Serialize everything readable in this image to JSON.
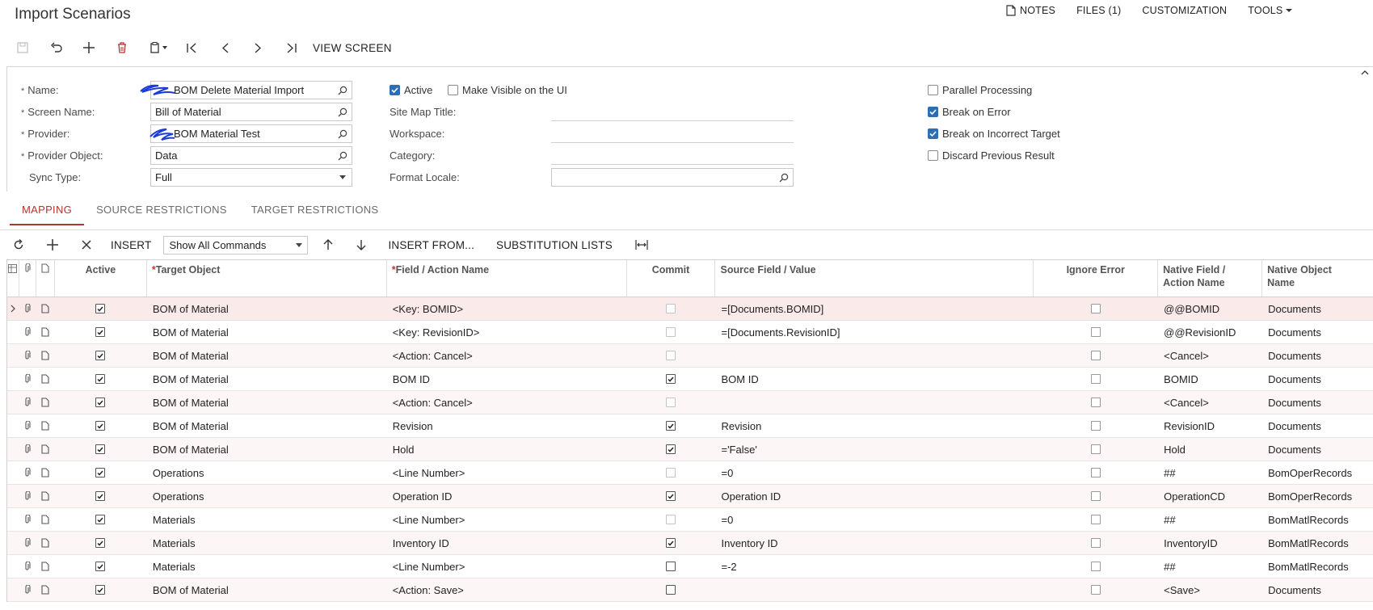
{
  "page": {
    "title": "Import Scenarios"
  },
  "topnav": {
    "notes": "NOTES",
    "files": "FILES (1)",
    "customization": "CUSTOMIZATION",
    "tools": "TOOLS"
  },
  "toolbar": {
    "view_screen": "VIEW SCREEN"
  },
  "form": {
    "name_label": "Name:",
    "name_value": "BOM Delete Material Import",
    "screen_label": "Screen Name:",
    "screen_value": "Bill of Material",
    "provider_label": "Provider:",
    "provider_value": "BOM Material Test",
    "provider_object_label": "Provider Object:",
    "provider_object_value": "Data",
    "sync_label": "Sync Type:",
    "sync_value": "Full",
    "active_label": "Active",
    "active_checked": true,
    "visible_label": "Make Visible on the UI",
    "visible_checked": false,
    "sitemap_label": "Site Map Title:",
    "workspace_label": "Workspace:",
    "category_label": "Category:",
    "locale_label": "Format Locale:",
    "parallel_label": "Parallel Processing",
    "parallel_checked": false,
    "break_error_label": "Break on Error",
    "break_error_checked": true,
    "break_target_label": "Break on Incorrect Target",
    "break_target_checked": true,
    "discard_label": "Discard Previous Result",
    "discard_checked": false
  },
  "tabs": [
    "MAPPING",
    "SOURCE RESTRICTIONS",
    "TARGET RESTRICTIONS"
  ],
  "grid_toolbar": {
    "insert": "INSERT",
    "show_commands": "Show All Commands",
    "insert_from": "INSERT FROM...",
    "substitution": "SUBSTITUTION LISTS"
  },
  "grid": {
    "headers": {
      "active": "Active",
      "target": "Target Object",
      "field": "Field / Action Name",
      "commit": "Commit",
      "source": "Source Field / Value",
      "ignore": "Ignore Error",
      "native_field_1": "Native Field /",
      "native_field_2": "Action Name",
      "native_object_1": "Native Object",
      "native_object_2": "Name"
    },
    "rows": [
      {
        "active": true,
        "target": "BOM of Material",
        "field": "<Key: BOMID>",
        "commit": false,
        "commit_disabled": true,
        "source": "=[Documents.BOMID]",
        "ignore": false,
        "native_field": "@@BOMID",
        "native_object": "Documents"
      },
      {
        "active": true,
        "target": "BOM of Material",
        "field": "<Key: RevisionID>",
        "commit": false,
        "commit_disabled": true,
        "source": "=[Documents.RevisionID]",
        "ignore": false,
        "native_field": "@@RevisionID",
        "native_object": "Documents"
      },
      {
        "active": true,
        "target": "BOM of Material",
        "field": "<Action: Cancel>",
        "commit": false,
        "commit_disabled": true,
        "source": "",
        "ignore": false,
        "native_field": "<Cancel>",
        "native_object": "Documents"
      },
      {
        "active": true,
        "target": "BOM of Material",
        "field": "BOM ID",
        "commit": true,
        "commit_disabled": false,
        "source": "BOM ID",
        "ignore": false,
        "native_field": "BOMID",
        "native_object": "Documents"
      },
      {
        "active": true,
        "target": "BOM of Material",
        "field": "<Action: Cancel>",
        "commit": false,
        "commit_disabled": true,
        "source": "",
        "ignore": false,
        "native_field": "<Cancel>",
        "native_object": "Documents"
      },
      {
        "active": true,
        "target": "BOM of Material",
        "field": "Revision",
        "commit": true,
        "commit_disabled": false,
        "source": "Revision",
        "ignore": false,
        "native_field": "RevisionID",
        "native_object": "Documents"
      },
      {
        "active": true,
        "target": "BOM of Material",
        "field": "Hold",
        "commit": true,
        "commit_disabled": false,
        "source": "='False'",
        "ignore": false,
        "native_field": "Hold",
        "native_object": "Documents"
      },
      {
        "active": true,
        "target": "Operations",
        "field": "<Line Number>",
        "commit": false,
        "commit_disabled": true,
        "source": "=0",
        "ignore": false,
        "native_field": "##",
        "native_object": "BomOperRecords"
      },
      {
        "active": true,
        "target": "Operations",
        "field": "Operation ID",
        "commit": true,
        "commit_disabled": false,
        "source": "Operation ID",
        "ignore": false,
        "native_field": "OperationCD",
        "native_object": "BomOperRecords"
      },
      {
        "active": true,
        "target": "Materials",
        "field": "<Line Number>",
        "commit": false,
        "commit_disabled": true,
        "source": "=0",
        "ignore": false,
        "native_field": "##",
        "native_object": "BomMatlRecords"
      },
      {
        "active": true,
        "target": "Materials",
        "field": "Inventory ID",
        "commit": true,
        "commit_disabled": false,
        "source": "Inventory ID",
        "ignore": false,
        "native_field": "InventoryID",
        "native_object": "BomMatlRecords"
      },
      {
        "active": true,
        "target": "Materials",
        "field": "<Line Number>",
        "commit": false,
        "commit_disabled": false,
        "source": "=-2",
        "ignore": false,
        "native_field": "##",
        "native_object": "BomMatlRecords"
      },
      {
        "active": true,
        "target": "BOM of Material",
        "field": "<Action: Save>",
        "commit": false,
        "commit_disabled": false,
        "source": "",
        "ignore": false,
        "native_field": "<Save>",
        "native_object": "Documents"
      }
    ]
  },
  "colors": {
    "accent": "#b3332f",
    "check": "#2d6fb5",
    "scribble": "#1a3bd6"
  }
}
